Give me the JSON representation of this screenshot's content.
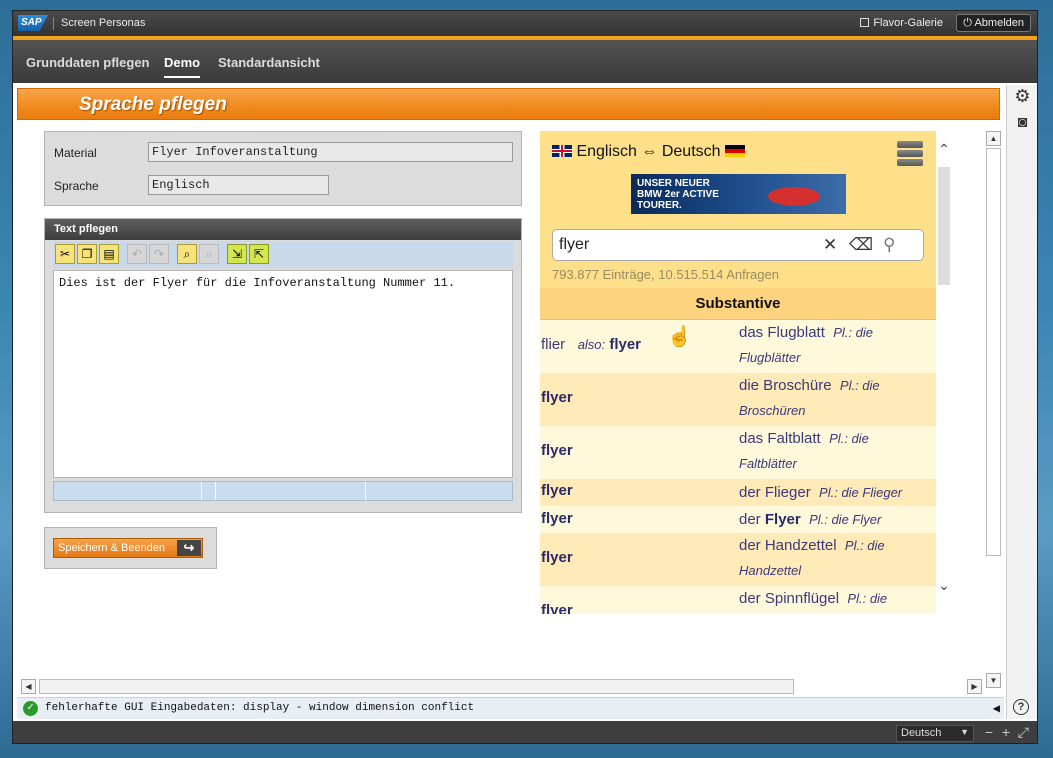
{
  "topbar": {
    "logo": "SAP",
    "app_title": "Screen Personas",
    "flavor_gallery": "Flavor-Galerie",
    "logout": "Abmelden"
  },
  "nav": {
    "tabs": [
      {
        "label": "Grunddaten pflegen",
        "active": false
      },
      {
        "label": "Demo",
        "active": true
      },
      {
        "label": "Standardansicht",
        "active": false
      }
    ]
  },
  "page": {
    "title": "Sprache pflegen"
  },
  "fields": {
    "material_label": "Material",
    "material_value": "Flyer Infoveranstaltung",
    "language_label": "Sprache",
    "language_value": "Englisch"
  },
  "text_panel": {
    "title": "Text pflegen",
    "content": "Dies ist der Flyer für die Infoveranstaltung Nummer 11."
  },
  "save_button": "Speichern & Beenden",
  "dictionary": {
    "lang_from": "Englisch",
    "arrow": "⇔",
    "lang_to": "Deutsch",
    "ad_text": [
      "UNSER NEUER",
      "BMW 2er ACTIVE",
      "TOURER."
    ],
    "search_value": "flyer",
    "stats": "793.877 Einträge, 10.515.514 Anfragen",
    "section": "Substantive",
    "entries": [
      {
        "en": "flier",
        "also": "also:",
        "also_word": "flyer",
        "de": "das Flugblatt",
        "gram": "Pl.: die Flugblätter"
      },
      {
        "en": "flyer",
        "de": "die Broschüre",
        "gram": "Pl.: die Broschüren"
      },
      {
        "en": "flyer",
        "de": "das Faltblatt",
        "gram": "Pl.: die Faltblätter"
      },
      {
        "en": "flyer",
        "de": "der Flieger",
        "gram": "Pl.: die Flieger"
      },
      {
        "en": "flyer",
        "de_pre": "der ",
        "de_bold": "Flyer",
        "gram": "Pl.: die Flyer"
      },
      {
        "en": "flyer",
        "de": "der Handzettel",
        "gram": "Pl.: die Handzettel"
      },
      {
        "en": "flyer",
        "de": "der Spinnflügel",
        "gram": "Pl.: die"
      }
    ]
  },
  "status": {
    "message": "fehlerhafte GUI Eingabedaten: display - window dimension conflict"
  },
  "bottombar": {
    "language": "Deutsch"
  },
  "colors": {
    "accent_orange": "#f0a21c",
    "header_orange": "#f08a1d",
    "dict_yellow": "#ffe08a"
  }
}
